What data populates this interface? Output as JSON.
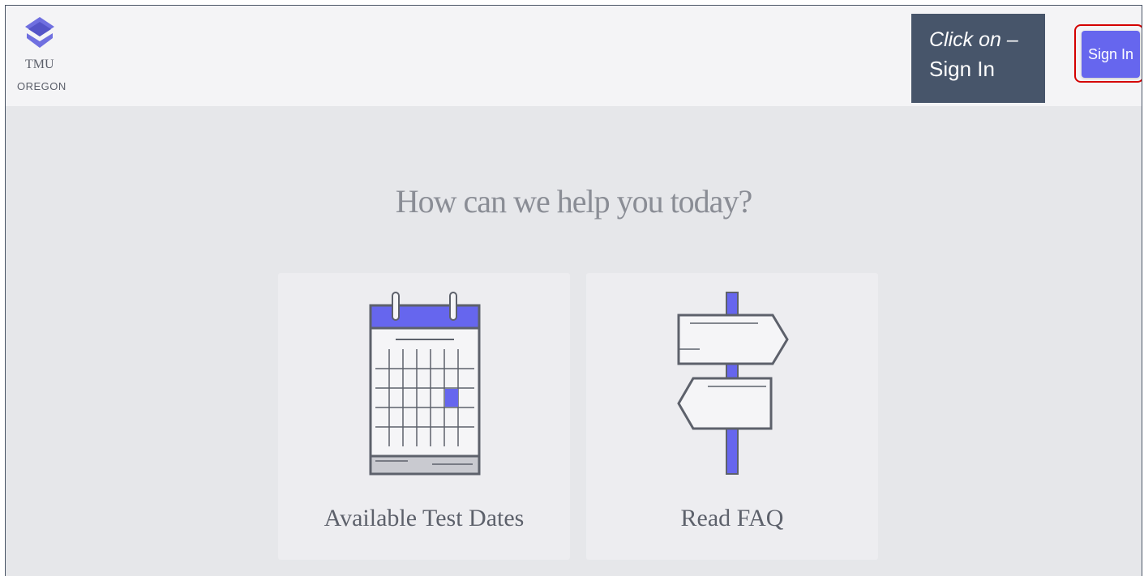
{
  "header": {
    "logo_title": "TMU",
    "logo_subtitle": "OREGON",
    "sign_in_label": "Sign In"
  },
  "callout": {
    "line1": "Click on –",
    "line2": "Sign In"
  },
  "main": {
    "heading": "How can we help you today?",
    "cards": [
      {
        "label": "Available Test Dates",
        "icon": "calendar-icon"
      },
      {
        "label": "Read FAQ",
        "icon": "signpost-icon"
      }
    ]
  },
  "colors": {
    "accent": "#6666ee",
    "callout_bg": "#47556a",
    "highlight": "#d40000"
  }
}
